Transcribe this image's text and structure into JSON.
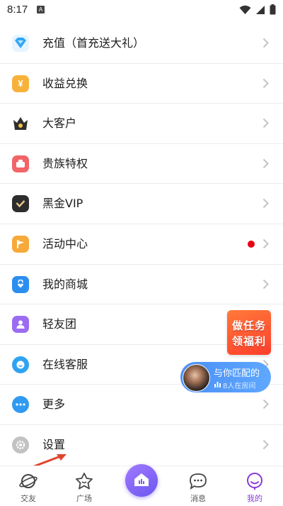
{
  "status": {
    "time": "8:17",
    "notif_letter": "A"
  },
  "menu": [
    {
      "label": "充值（首充送大礼）",
      "icon": "diamond-icon",
      "color": "#2ea6f5"
    },
    {
      "label": "收益兑换",
      "icon": "yuan-coin-icon",
      "color": "#f7b23b"
    },
    {
      "label": "大客户",
      "icon": "crown-icon",
      "color": "#2f2f2f"
    },
    {
      "label": "贵族特权",
      "icon": "noble-gift-icon",
      "color": "#f26567"
    },
    {
      "label": "黑金VIP",
      "icon": "vip-check-icon",
      "color": "#2d2d2d"
    },
    {
      "label": "活动中心",
      "icon": "flag-icon",
      "color": "#f7a93a",
      "badge": "red-dot"
    },
    {
      "label": "我的商城",
      "icon": "shopping-bag-icon",
      "color": "#2b8ff0"
    },
    {
      "label": "轻友团",
      "icon": "group-user-icon",
      "color": "#9b6cf2"
    },
    {
      "label": "在线客服",
      "icon": "chat-support-icon",
      "color": "#2fa3f2"
    },
    {
      "label": "更多",
      "icon": "more-dots-icon",
      "color": "#2f9af0"
    },
    {
      "label": "设置",
      "icon": "gear-icon",
      "color": "#b9b9b9"
    }
  ],
  "floating": {
    "task_line1": "做任务",
    "task_line2": "领福利",
    "match_title": "与你匹配的",
    "match_sub": "8人在房间"
  },
  "nav": [
    {
      "label": "交友",
      "icon": "planet-icon"
    },
    {
      "label": "广场",
      "icon": "star-face-icon"
    },
    {
      "label": "",
      "icon": "home-live-icon"
    },
    {
      "label": "消息",
      "icon": "message-icon"
    },
    {
      "label": "我的",
      "icon": "profile-icon",
      "active": true
    }
  ],
  "colors": {
    "accent": "#7b5cf0",
    "active_tab": "#8a3bd8",
    "chevron": "#c4c4c4",
    "arrow": "#e0442b"
  }
}
